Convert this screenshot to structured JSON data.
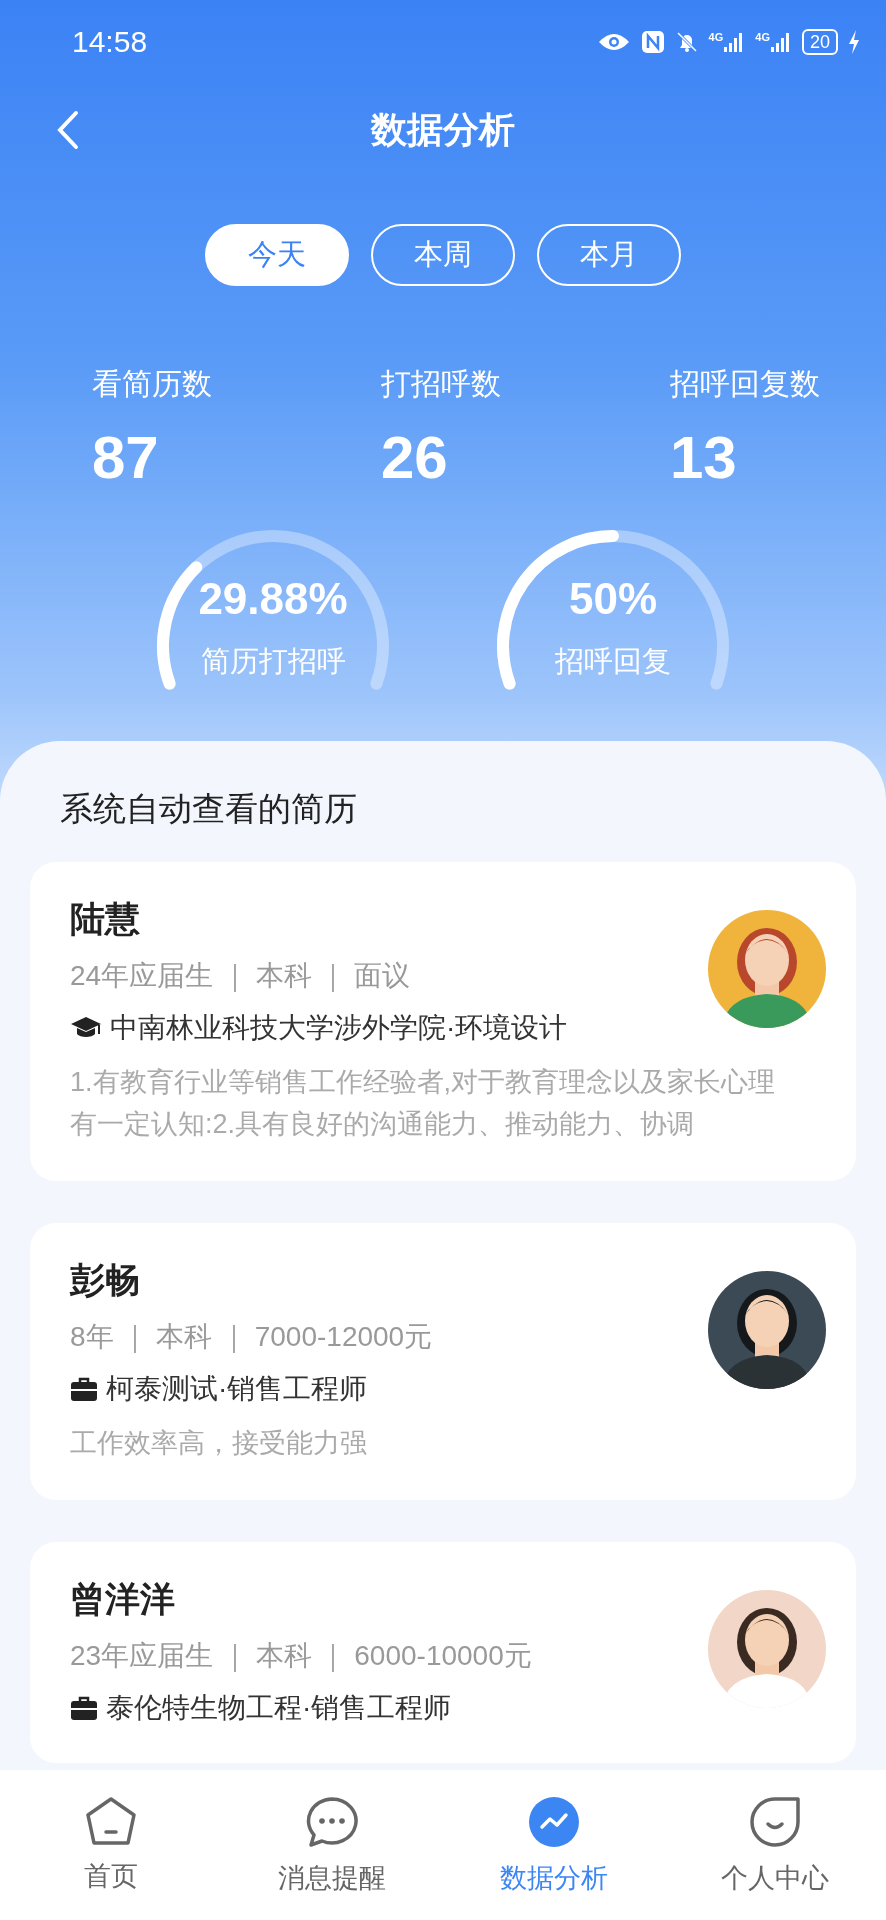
{
  "status_bar": {
    "time": "14:58",
    "network": [
      "4G",
      "4G"
    ],
    "battery": "20"
  },
  "header": {
    "title": "数据分析"
  },
  "tabs": [
    {
      "label": "今天",
      "selected": true
    },
    {
      "label": "本周",
      "selected": false
    },
    {
      "label": "本月",
      "selected": false
    }
  ],
  "stats": [
    {
      "label": "看简历数",
      "value": "87"
    },
    {
      "label": "打招呼数",
      "value": "26"
    },
    {
      "label": "招呼回复数",
      "value": "13"
    }
  ],
  "gauges": [
    {
      "reading": "29.88%",
      "label": "简历打招呼"
    },
    {
      "reading": "50%",
      "label": "招呼回复"
    }
  ],
  "section_title": "系统自动查看的简历",
  "resumes": [
    {
      "name": "陆慧",
      "meta": "24年应届生 ｜ 本科 ｜ 面议",
      "kind": "school",
      "org": "中南林业科技大学涉外学院·环境设计",
      "summary": "1.有教育行业等销售工作经验者,对于教育理念以及家长心理有一定认知:2.具有良好的沟通能力、推动能力、协调"
    },
    {
      "name": "彭畅",
      "meta": "8年 ｜ 本科 ｜ 7000-12000元",
      "kind": "work",
      "org": "柯泰测试·销售工程师",
      "summary": "工作效率高，接受能力强"
    },
    {
      "name": "曾洋洋",
      "meta": "23年应届生 ｜ 本科 ｜ 6000-10000元",
      "kind": "work",
      "org": "泰伦特生物工程·销售工程师"
    }
  ],
  "nav": [
    {
      "label": "首页",
      "kind": "home",
      "selected": false
    },
    {
      "label": "消息提醒",
      "kind": "chat",
      "selected": false
    },
    {
      "label": "数据分析",
      "kind": "chart",
      "selected": true
    },
    {
      "label": "个人中心",
      "kind": "profile",
      "selected": false
    }
  ]
}
